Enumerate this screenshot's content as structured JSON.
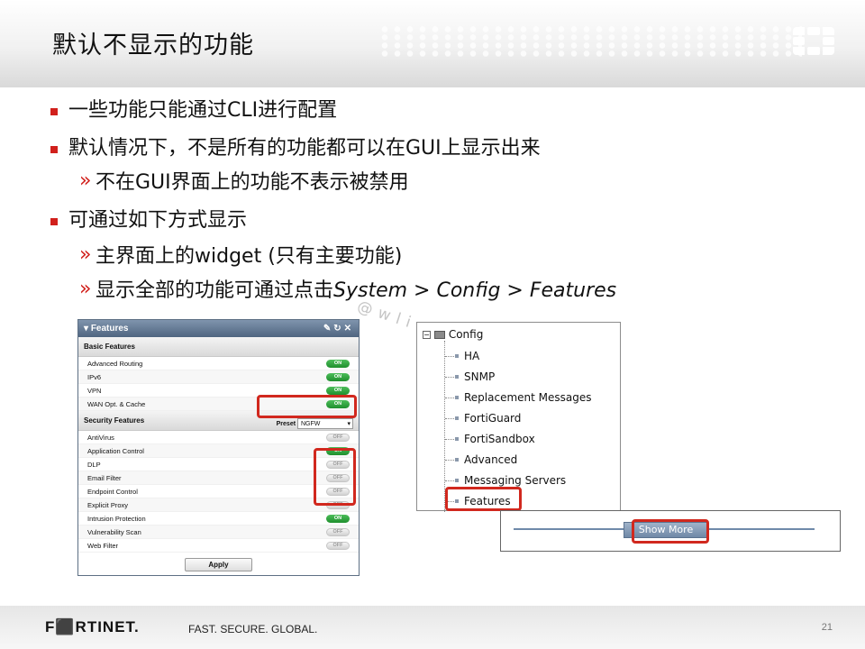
{
  "slide": {
    "title": "默认不显示的功能",
    "page_number": "21"
  },
  "bullets": [
    {
      "text": "一些功能只能通过CLI进行配置"
    },
    {
      "text": "默认情况下，不是所有的功能都可以在GUI上显示出来",
      "sub": [
        "不在GUI界面上的功能不表示被禁用"
      ]
    },
    {
      "text": "可通过如下方式显示",
      "sub": [
        "主界面上的widget (只有主要功能)",
        "显示全部的功能可通过点击"
      ],
      "sub_italic": "System > Config > Features"
    }
  ],
  "sub_marker": "»",
  "features_panel": {
    "title": "Features",
    "basic_title": "Basic Features",
    "basic": [
      {
        "name": "Advanced Routing",
        "state": "ON"
      },
      {
        "name": "IPv6",
        "state": "ON"
      },
      {
        "name": "VPN",
        "state": "ON"
      },
      {
        "name": "WAN Opt. & Cache",
        "state": "ON"
      }
    ],
    "security_title": "Security Features",
    "preset_label": "Preset",
    "preset_value": "NGFW",
    "security": [
      {
        "name": "AntiVirus",
        "state": "OFF"
      },
      {
        "name": "Application Control",
        "state": "ON"
      },
      {
        "name": "DLP",
        "state": "OFF"
      },
      {
        "name": "Email Filter",
        "state": "OFF"
      },
      {
        "name": "Endpoint Control",
        "state": "OFF"
      },
      {
        "name": "Explicit Proxy",
        "state": "OFF"
      },
      {
        "name": "Intrusion Protection",
        "state": "ON"
      },
      {
        "name": "Vulnerability Scan",
        "state": "OFF"
      },
      {
        "name": "Web Filter",
        "state": "OFF"
      }
    ],
    "apply_label": "Apply"
  },
  "config_tree": {
    "root": "Config",
    "items": [
      "HA",
      "SNMP",
      "Replacement Messages",
      "FortiGuard",
      "FortiSandbox",
      "Advanced",
      "Messaging Servers",
      "Features"
    ]
  },
  "show_more": {
    "label": "Show More"
  },
  "watermark": "@wlinfowz",
  "footer": {
    "brand": "F⬛RTINET.",
    "tagline": "FAST. SECURE. GLOBAL."
  },
  "colors": {
    "accent_red": "#d1201c",
    "panel_blue": "#5d6f84",
    "toggle_on": "#1f8f2e"
  }
}
